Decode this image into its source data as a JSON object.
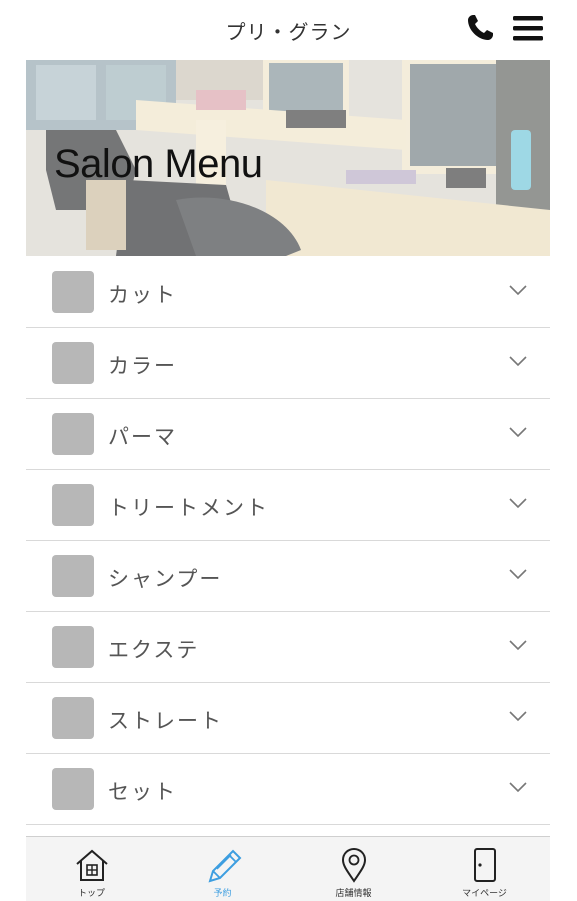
{
  "header": {
    "title": "プリ・グラン",
    "phone_icon": "phone-icon",
    "menu_icon": "hamburger-menu-icon"
  },
  "hero": {
    "title": "Salon Menu"
  },
  "menu": {
    "items": [
      {
        "label": "カット"
      },
      {
        "label": "カラー"
      },
      {
        "label": "パーマ"
      },
      {
        "label": "トリートメント"
      },
      {
        "label": "シャンプー"
      },
      {
        "label": "エクステ"
      },
      {
        "label": "ストレート"
      },
      {
        "label": "セット"
      }
    ]
  },
  "tabbar": {
    "tabs": [
      {
        "label": "トップ",
        "icon": "home-icon"
      },
      {
        "label": "予約",
        "icon": "pencil-icon",
        "active": true
      },
      {
        "label": "店舗情報",
        "icon": "location-pin-icon"
      },
      {
        "label": "マイページ",
        "icon": "door-icon"
      }
    ]
  },
  "colors": {
    "active_tab": "#3d9ee0",
    "thumb": "#b7b7b7",
    "divider": "#d9d9d9"
  }
}
